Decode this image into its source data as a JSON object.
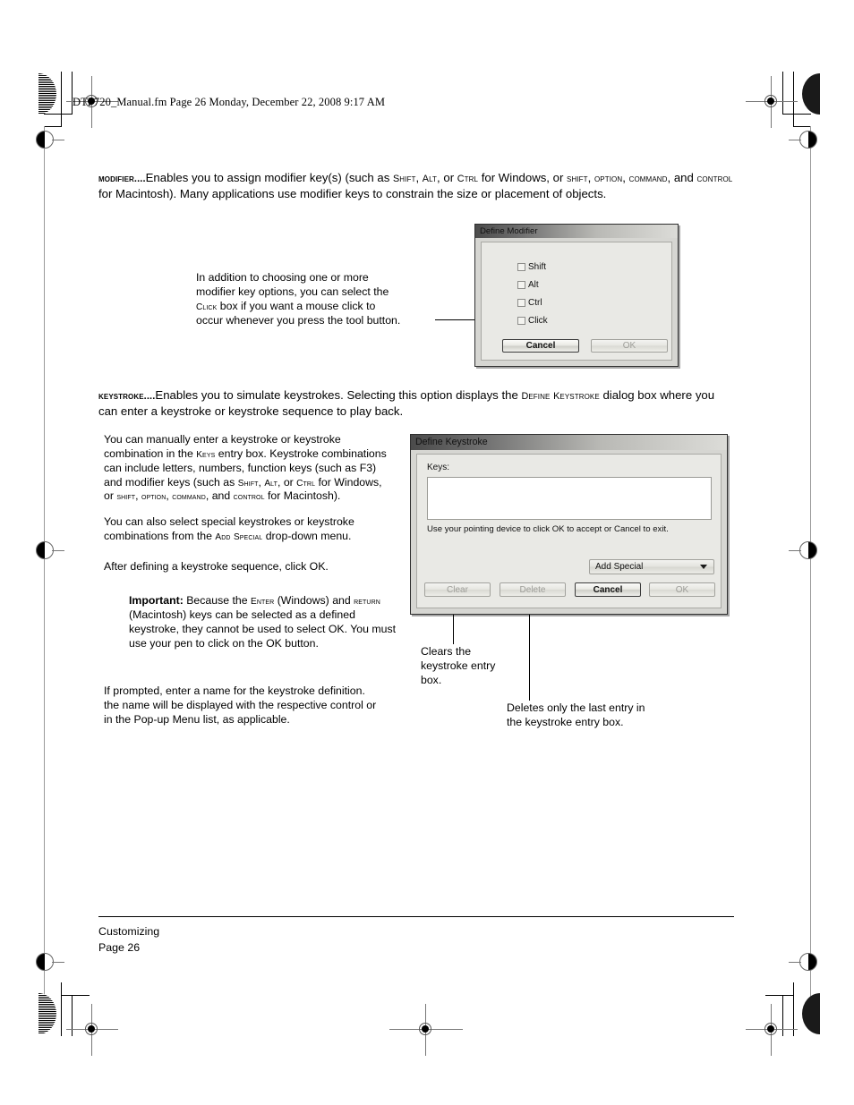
{
  "header": {
    "file_info": "DTF720_Manual.fm  Page 26  Monday, December 22, 2008  9:17 AM"
  },
  "sections": {
    "modifier": {
      "term": "Modifier....",
      "body_line1_a": "Enables you to assign modifier key(s) (such as ",
      "sc_shift": "Shift",
      "body_line1_b": ", ",
      "sc_alt": "Alt",
      "body_line1_c": ", or ",
      "sc_ctrl": "Ctrl",
      "body_line1_d": " for Windows, or ",
      "sc_shift2": "shift",
      "body_line1_e": ",",
      "sc_option": "option",
      "body_line2_a": ", ",
      "sc_command": "command",
      "body_line2_b": ", and ",
      "sc_control": "control",
      "body_line2_c": " for Macintosh).  Many applications use modifier keys to constrain the size or placement of objects."
    },
    "keystroke": {
      "term": "Keystroke....",
      "body_a": "Enables you to simulate keystrokes.  Selecting this option displays the ",
      "sc_define": "Define",
      "body_b": " ",
      "sc_keystroke": "Keystroke",
      "body_c": " dialog box where you can enter a keystroke or keystroke sequence to play back."
    }
  },
  "callouts": {
    "click_box": {
      "line1": "In addition to choosing one or more",
      "line2": "modifier key options, you can select the",
      "line3_sc": "Click",
      "line3_rest": " box if you want a mouse click to",
      "line4": "occur whenever you press the tool button."
    },
    "clear_button": "Clears the\nkeystroke entry\nbox.",
    "delete_button": "Deletes only the last entry in\nthe keystroke entry box."
  },
  "left_column": {
    "p1_a": "You can manually enter a keystroke or keystroke combination in the ",
    "p1_sc_keys": "Keys",
    "p1_b": " entry box.  Keystroke combinations can include letters, numbers, function keys (such as F3) and modifier keys (such as ",
    "p1_sc_shift": "Shift",
    "p1_c": ", ",
    "p1_sc_alt": "Alt",
    "p1_d": ", or ",
    "p1_sc_ctrl": "Ctrl",
    "p1_e": " for Windows, or ",
    "p1_sc_shift2": "shift",
    "p1_f": ", ",
    "p1_sc_option": "option",
    "p1_g": ", ",
    "p1_sc_command": "command",
    "p1_h": ", and ",
    "p1_sc_control": "control",
    "p1_i": " for Macintosh).",
    "p2_a": "You can also select special keystrokes or keystroke combinations from the ",
    "p2_sc_add": "Add",
    "p2_b": " ",
    "p2_sc_special": "Special",
    "p2_c": " drop-down menu.",
    "p3": "After defining a keystroke sequence, click OK.",
    "important_label": "Important:",
    "important_a": " Because the ",
    "important_sc_enter": "Enter",
    "important_b": " (Windows) and ",
    "important_sc_return": "return",
    "important_c": " (Macintosh) keys can be selected as a defined keystroke, they cannot be used to select OK.  You must use your pen to click on the OK button.",
    "p4": "If prompted, enter a name for the keystroke definition.  the name will be displayed with the respective control or in the Pop-up Menu list, as applicable."
  },
  "define_modifier_dialog": {
    "title": "Define Modifier",
    "checkboxes": [
      {
        "label": "Shift",
        "checked": false
      },
      {
        "label": "Alt",
        "checked": false
      },
      {
        "label": "Ctrl",
        "checked": false
      },
      {
        "label": "Click",
        "checked": false
      }
    ],
    "cancel_label": "Cancel",
    "ok_label": "OK",
    "ok_disabled": true
  },
  "define_keystroke_dialog": {
    "title": "Define Keystroke",
    "keys_label": "Keys:",
    "keys_value": "",
    "hint": "Use your pointing device to click OK to accept or Cancel to exit.",
    "add_special_label": "Add Special",
    "clear_label": "Clear",
    "delete_label": "Delete",
    "cancel_label": "Cancel",
    "ok_label": "OK",
    "clear_disabled": true,
    "delete_disabled": true,
    "ok_disabled": true
  },
  "footer": {
    "chapter": "Customizing",
    "page": "Page  26"
  }
}
